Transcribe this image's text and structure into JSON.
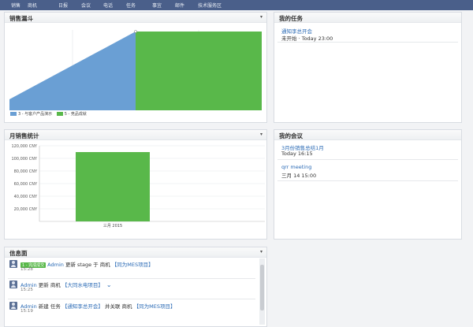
{
  "nav": {
    "items": [
      "销售",
      "商机",
      "日报",
      "会议",
      "电话",
      "任务",
      "事宜",
      "邮件",
      "技术服务区"
    ]
  },
  "funnel_panel": {
    "title": "销售漏斗",
    "legend": [
      "3 - 与客户产品演示",
      "5 - 竞品成就"
    ]
  },
  "tasks_panel": {
    "title": "我的任务",
    "items": [
      {
        "name": "通知李总开会",
        "status": "未开始 · Today 23:00"
      }
    ]
  },
  "monthly_panel": {
    "title": "月销售统计"
  },
  "meetings_panel": {
    "title": "我的会议",
    "items": [
      {
        "name": "3月份销售总结1月",
        "time": "Today 16:15"
      },
      {
        "name": "qrr meeting",
        "time": "三月 14 15:00"
      }
    ]
  },
  "feed_panel": {
    "title": "信息面",
    "items": [
      {
        "badge": "1 - 完成成交",
        "user": "Admin",
        "text": " 更新 stage 于 商机 ",
        "link": "【同为MES项目】",
        "time": "15:28"
      },
      {
        "badge": "",
        "user": "Admin",
        "text": " 更新 商机 ",
        "link": "【大同水电项目】",
        "time": "15:25"
      },
      {
        "badge": "",
        "user": "Admin",
        "text": " 新建 任务 ",
        "link": "【通知李总开会】",
        "text2": " 并关联 商机 ",
        "link2": "【同为MES项目】",
        "time": "15:19"
      }
    ]
  },
  "colors": {
    "nav_bg": "#4a5f8a",
    "series_blue": "#6a9fd4",
    "series_green": "#59b84a",
    "link": "#2a6ab5"
  },
  "chart_data": [
    {
      "type": "area",
      "title": "销售漏斗",
      "series": [
        {
          "name": "3 - 与客户产品演示",
          "color": "#6a9fd4"
        },
        {
          "name": "5 - 竞品成就",
          "color": "#59b84a"
        }
      ]
    },
    {
      "type": "bar",
      "title": "月销售统计",
      "categories": [
        "三月 2015"
      ],
      "values": [
        110000
      ],
      "ylim": [
        0,
        120000
      ],
      "yticks": [
        "120,000 CNY",
        "100,000 CNY",
        "80,000 CNY",
        "60,000 CNY",
        "40,000 CNY",
        "20,000 CNY"
      ],
      "color": "#59b84a",
      "grid": true
    }
  ]
}
